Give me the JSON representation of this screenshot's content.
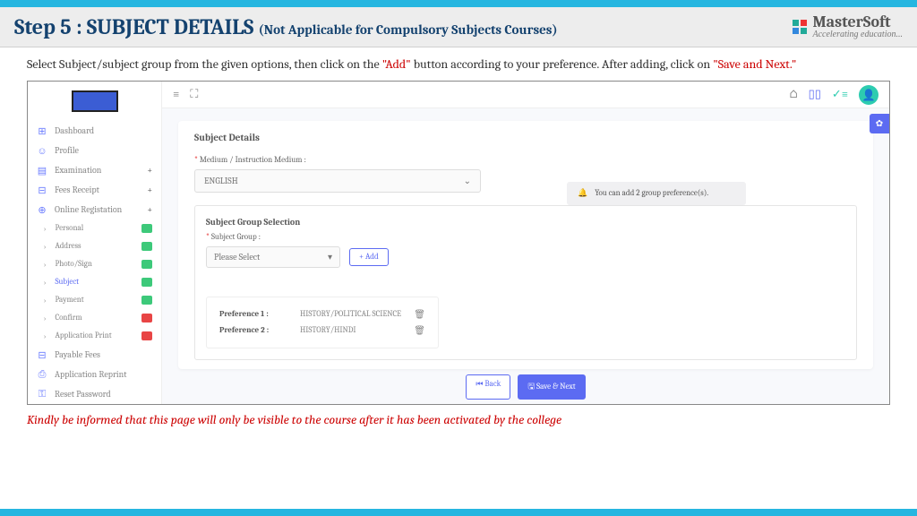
{
  "header": {
    "step": "Step 5 : SUBJECT DETAILS",
    "sub": "(Not Applicable for Compulsory Subjects Courses)",
    "logo_main": "MasterSoft",
    "logo_tag": "Accelerating education..."
  },
  "instruction": {
    "p1": "Select Subject/subject group from the given options, then click on the ",
    "add": "\"Add\"",
    "p2": " button according to your preference. After adding, click on ",
    "save": "\"Save and Next.\""
  },
  "sidebar": {
    "items": [
      {
        "label": "Dashboard",
        "icon": "⊞"
      },
      {
        "label": "Profile",
        "icon": "☺"
      },
      {
        "label": "Examination",
        "icon": "▤",
        "plus": true
      },
      {
        "label": "Fees Receipt",
        "icon": "⊟",
        "plus": true
      },
      {
        "label": "Online Registation",
        "icon": "⊕",
        "plus": true
      }
    ],
    "subs": [
      {
        "label": "Personal",
        "status": "g"
      },
      {
        "label": "Address",
        "status": "g"
      },
      {
        "label": "Photo/Sign",
        "status": "g"
      },
      {
        "label": "Subject",
        "status": "g",
        "active": true
      },
      {
        "label": "Payment",
        "status": "g"
      },
      {
        "label": "Confirm",
        "status": "r"
      },
      {
        "label": "Application Print",
        "status": "r"
      }
    ],
    "extras": [
      {
        "label": "Payable Fees",
        "icon": "⊟"
      },
      {
        "label": "Application Reprint",
        "icon": "⎙"
      },
      {
        "label": "Reset Password",
        "icon": "⚿"
      }
    ]
  },
  "topnav": {
    "home": "⌂",
    "book": "▯▯",
    "check": "✓≡"
  },
  "card": {
    "title": "Subject Details",
    "medium_label": "Medium / Instruction Medium :",
    "medium_value": "ENGLISH",
    "sg_title": "Subject Group Selection",
    "sg_label": "Subject Group :",
    "sg_placeholder": "Please Select",
    "add_btn": "+ Add",
    "alert": "You can add 2 group preference(s).",
    "prefs": [
      {
        "label": "Preference 1 :",
        "value": "HISTORY/POLITICAL SCIENCE"
      },
      {
        "label": "Preference 2 :",
        "value": "HISTORY/HINDI"
      }
    ],
    "back": "⏮ Back",
    "save": "🖫 Save & Next"
  },
  "footer": "Kindly be informed that this page will only be visible to the course after it has been activated by the college"
}
